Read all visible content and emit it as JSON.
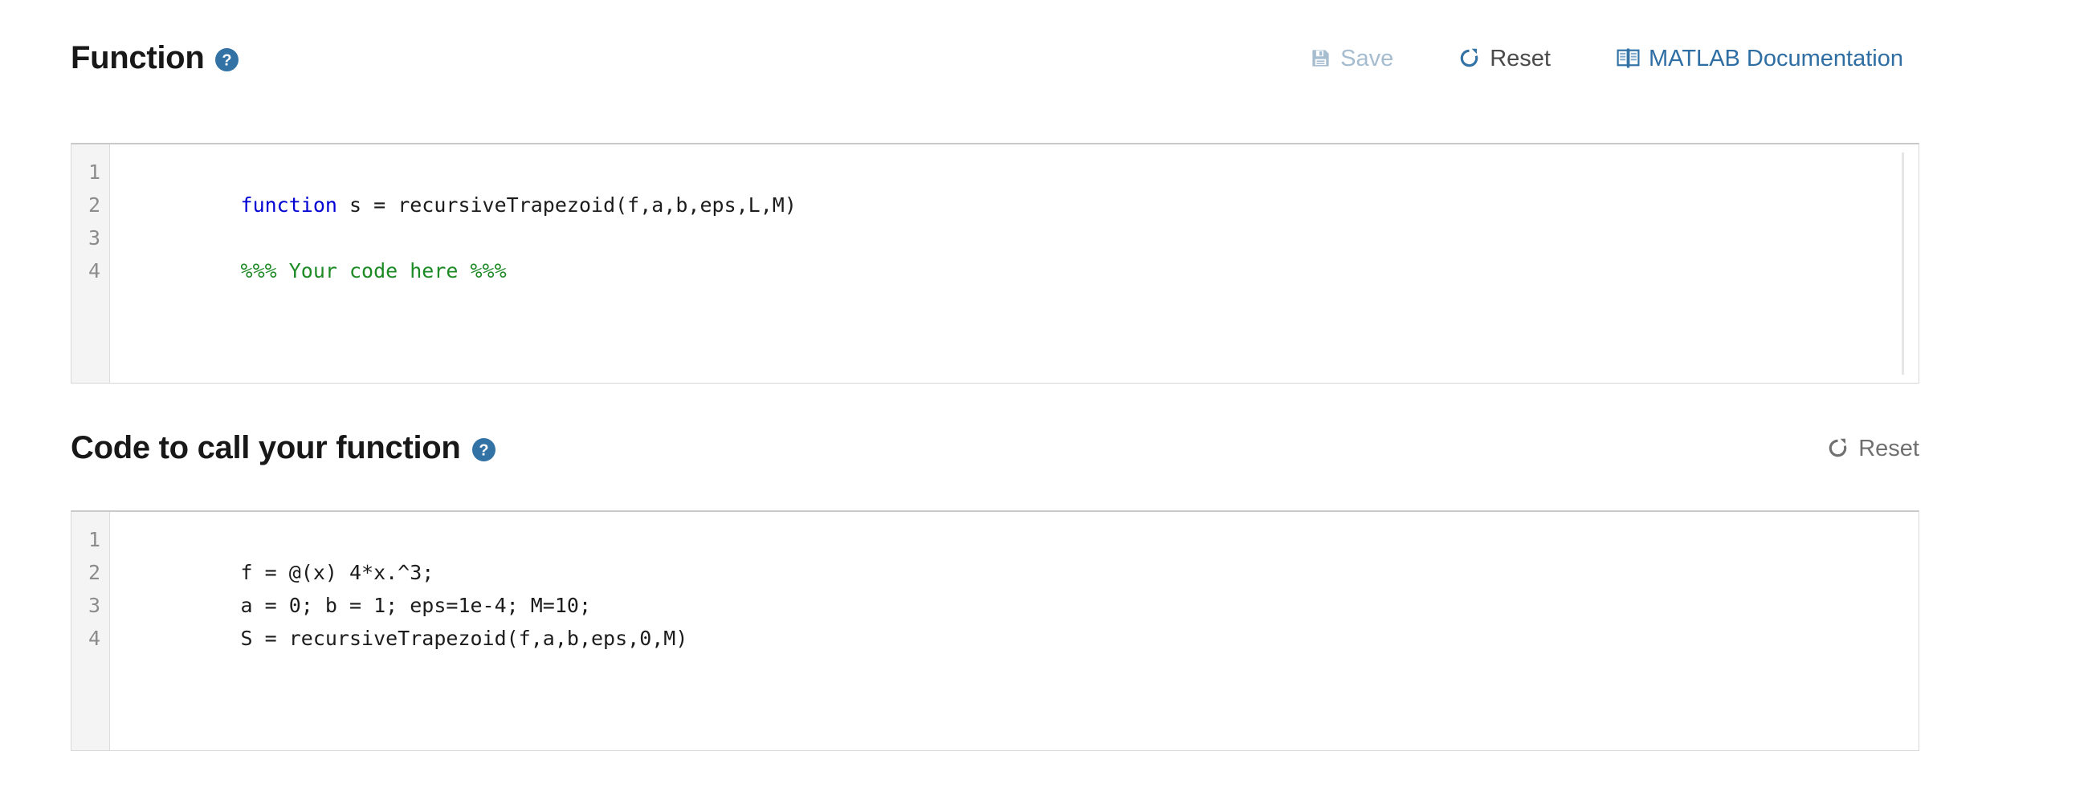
{
  "sections": [
    {
      "title": "Function",
      "help_icon": "help-circle-icon",
      "toolbar": [
        {
          "id": "save",
          "label": "Save",
          "icon": "floppy-disk-save-icon",
          "state": "disabled"
        },
        {
          "id": "reset",
          "label": "Reset",
          "icon": "refresh-reset-icon",
          "state": "enabled"
        },
        {
          "id": "doc",
          "label": "MATLAB Documentation",
          "icon": "open-book-icon",
          "state": "enabled"
        }
      ],
      "editor": {
        "line_numbers": [
          "1",
          "2",
          "3",
          "4"
        ],
        "lines": [
          {
            "n": "1",
            "parts": [
              {
                "text": "function",
                "tok": "kw"
              },
              {
                "text": " s = recursiveTrapezoid(f,a,b,eps,L,M)",
                "tok": ""
              }
            ]
          },
          {
            "n": "2",
            "parts": [
              {
                "text": "",
                "tok": ""
              }
            ]
          },
          {
            "n": "3",
            "parts": [
              {
                "text": "%%% Your code here %%%",
                "tok": "comment"
              }
            ]
          },
          {
            "n": "4",
            "parts": [
              {
                "text": "",
                "tok": ""
              }
            ]
          }
        ]
      }
    },
    {
      "title": "Code to call your function",
      "help_icon": "help-circle-icon",
      "toolbar": [
        {
          "id": "reset2",
          "label": "Reset",
          "icon": "refresh-reset-icon",
          "state": "muted"
        }
      ],
      "editor": {
        "line_numbers": [
          "1",
          "2",
          "3",
          "4"
        ],
        "lines": [
          {
            "n": "1",
            "parts": [
              {
                "text": "f = @(x) 4*x.^3;",
                "tok": ""
              }
            ]
          },
          {
            "n": "2",
            "parts": [
              {
                "text": "a = 0; b = 1; eps=1e-4; M=10;",
                "tok": ""
              }
            ]
          },
          {
            "n": "3",
            "parts": [
              {
                "text": "S = recursiveTrapezoid(f,a,b,eps,0,M)",
                "tok": ""
              }
            ]
          },
          {
            "n": "4",
            "parts": [
              {
                "text": "",
                "tok": ""
              }
            ]
          }
        ]
      }
    }
  ],
  "colors": {
    "accent_blue": "#3272a5",
    "link_blue": "#2f6ea3",
    "disabled_blue": "#a6bdd0",
    "reset_label": "#4a4a4a",
    "reset_label_muted": "#707070",
    "keyword": "#0000d2",
    "comment": "#1d8a25",
    "gutter_bg": "#f4f4f4",
    "gutter_text": "#8c8c8c",
    "editor_border": "#d8d8d8"
  }
}
